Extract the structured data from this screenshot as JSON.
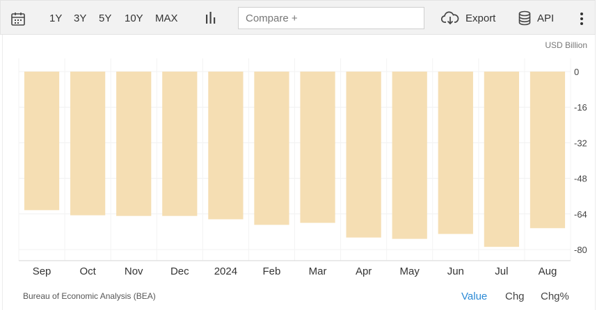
{
  "toolbar": {
    "ranges": [
      "1Y",
      "3Y",
      "5Y",
      "10Y",
      "MAX"
    ],
    "compare_placeholder": "Compare +",
    "export_label": "Export",
    "api_label": "API"
  },
  "footer": {
    "source": "Bureau of Economic Analysis (BEA)",
    "toggles": [
      "Value",
      "Chg",
      "Chg%"
    ],
    "active_toggle": "Value"
  },
  "colors": {
    "bar": "#f5deb3",
    "active_toggle": "#2b8ad6"
  },
  "chart_data": {
    "type": "bar",
    "unit_label": "USD Billion",
    "categories": [
      "Sep",
      "Oct",
      "Nov",
      "Dec",
      "2024",
      "Feb",
      "Mar",
      "Apr",
      "May",
      "Jun",
      "Jul",
      "Aug"
    ],
    "values": [
      -62.3,
      -64.6,
      -64.9,
      -64.9,
      -66.4,
      -68.9,
      -68.0,
      -74.6,
      -75.2,
      -73.0,
      -78.8,
      -70.4
    ],
    "yticks": [
      0,
      -16,
      -32,
      -48,
      -64,
      -80
    ],
    "ylim": [
      -85,
      0
    ],
    "grid": true
  }
}
